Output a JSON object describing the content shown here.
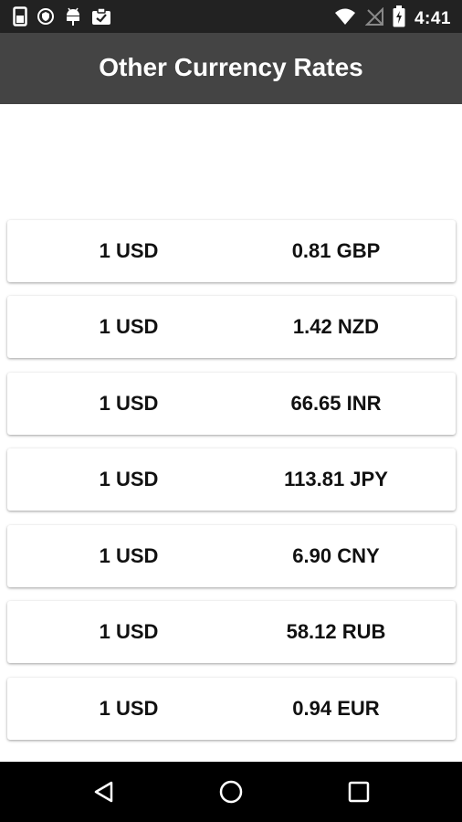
{
  "status_bar": {
    "time": "4:41",
    "icons_left": [
      "sim-card-icon",
      "shield-icon",
      "android-icon",
      "clipboard-check-icon"
    ],
    "icons_right": [
      "wifi-icon",
      "no-signal-icon",
      "battery-charging-icon"
    ]
  },
  "app_bar": {
    "title": "Other Currency Rates"
  },
  "rates": [
    {
      "base": "1 USD",
      "value": "0.81 GBP"
    },
    {
      "base": "1 USD",
      "value": "1.42 NZD"
    },
    {
      "base": "1 USD",
      "value": "66.65 INR"
    },
    {
      "base": "1 USD",
      "value": "113.81 JPY"
    },
    {
      "base": "1 USD",
      "value": "6.90 CNY"
    },
    {
      "base": "1 USD",
      "value": "58.12 RUB"
    },
    {
      "base": "1 USD",
      "value": "0.94 EUR"
    }
  ],
  "nav_bar": {
    "buttons": [
      "back-icon",
      "home-icon",
      "recents-icon"
    ]
  }
}
